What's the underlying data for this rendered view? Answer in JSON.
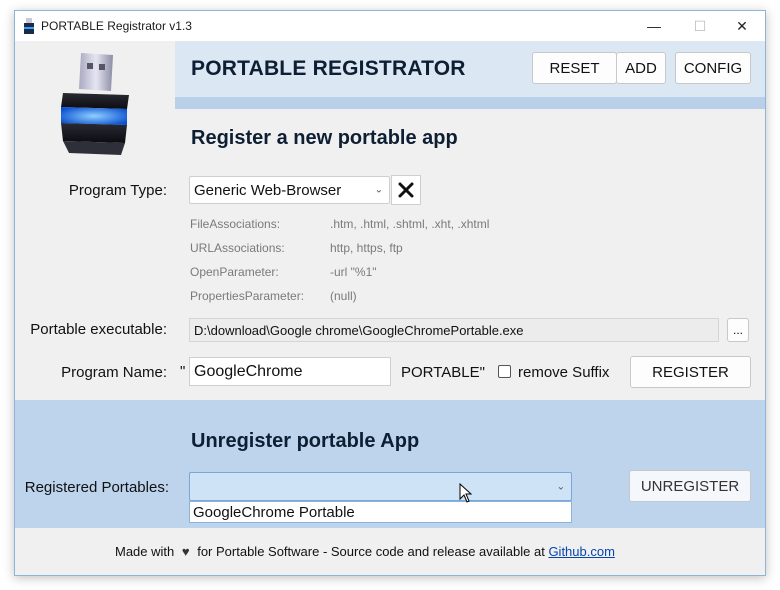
{
  "window": {
    "title": "PORTABLE Registrator v1.3",
    "controls": {
      "minimize": "—",
      "maximize": "☐",
      "close": "✕"
    }
  },
  "header": {
    "app_title": "PORTABLE REGISTRATOR",
    "buttons": {
      "reset": "RESET",
      "add": "ADD",
      "config": "CONFIG"
    }
  },
  "register": {
    "section_title": "Register a new portable app",
    "program_type_label": "Program Type:",
    "program_type_value": "Generic Web-Browser",
    "clear_icon": "x-icon",
    "info": [
      {
        "key": "FileAssociations:",
        "value": ".htm, .html, .shtml, .xht, .xhtml"
      },
      {
        "key": "URLAssociations:",
        "value": "http, https, ftp"
      },
      {
        "key": "OpenParameter:",
        "value": "-url \"%1\""
      },
      {
        "key": "PropertiesParameter:",
        "value": "(null)"
      }
    ],
    "executable_label": "Portable executable:",
    "executable_value": "D:\\download\\Google chrome\\GoogleChromePortable.exe",
    "browse_label": "...",
    "program_name_label": "Program Name:",
    "open_quote": "\"",
    "program_name_value": "GoogleChrome",
    "suffix_text": "PORTABLE\"",
    "remove_suffix_label": "remove Suffix",
    "remove_suffix_checked": false,
    "register_button": "REGISTER"
  },
  "unregister": {
    "section_title": "Unregister portable App",
    "registered_label": "Registered Portables:",
    "selected_value": "",
    "options": [
      "GoogleChrome Portable"
    ],
    "unregister_button": "UNREGISTER"
  },
  "footer": {
    "before_heart": "Made with",
    "heart_icon": "heart-icon",
    "after_heart": "for Portable Software - Source code and release available at",
    "link_text": "Github.com"
  },
  "colors": {
    "header_band": "#dbe8f4",
    "lower_band": "#bdd4ec",
    "link": "#0645ad"
  }
}
